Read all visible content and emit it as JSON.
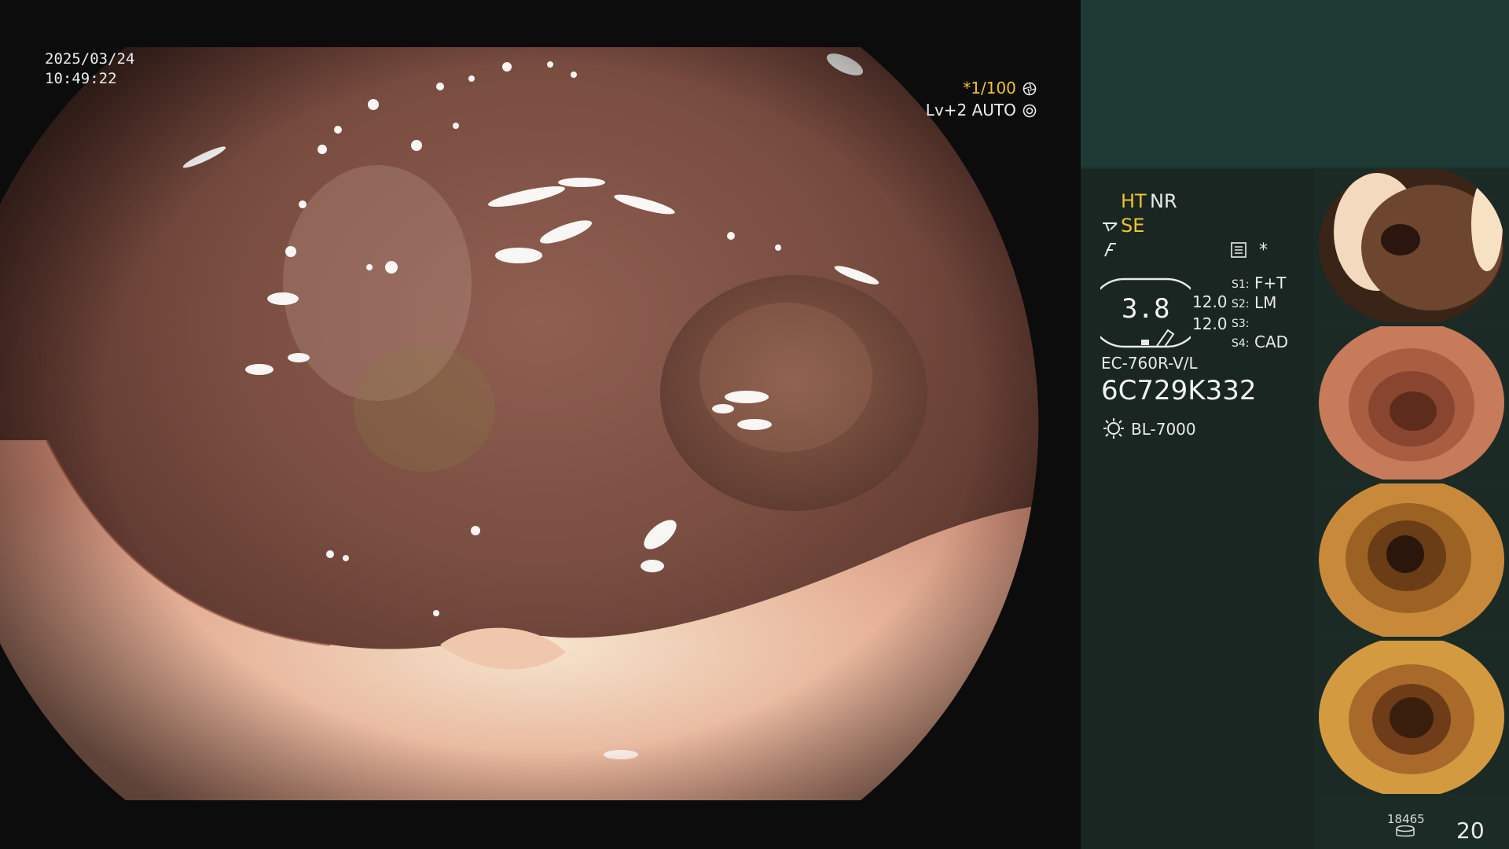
{
  "overlay": {
    "date": "2025/03/24",
    "time": "10:49:22",
    "shutter": "*1/100",
    "shutter_icon": "aperture-icon",
    "level_mode": "Lv+2 AUTO",
    "level_icon": "iris-icon"
  },
  "panel": {
    "mode_ht": "HT",
    "mode_nr": "NR",
    "mode_se": "SE",
    "asterisk": "*",
    "gauge_value": "3.8",
    "value_a": "12.0",
    "value_b": "12.0",
    "switches": [
      {
        "key": "S1:",
        "value": "F+T"
      },
      {
        "key": "S2:",
        "value": "LM"
      },
      {
        "key": "S3:",
        "value": ""
      },
      {
        "key": "S4:",
        "value": "CAD"
      }
    ],
    "scope_model": "EC-760R-V/L",
    "scope_serial": "6C729K332",
    "light_source": "BL-7000",
    "counter_small": "18465",
    "counter_big": "20"
  },
  "colors": {
    "accent_yellow": "#f2c230",
    "panel_bg": "#192622",
    "top_box_bg": "#1e3a34"
  }
}
